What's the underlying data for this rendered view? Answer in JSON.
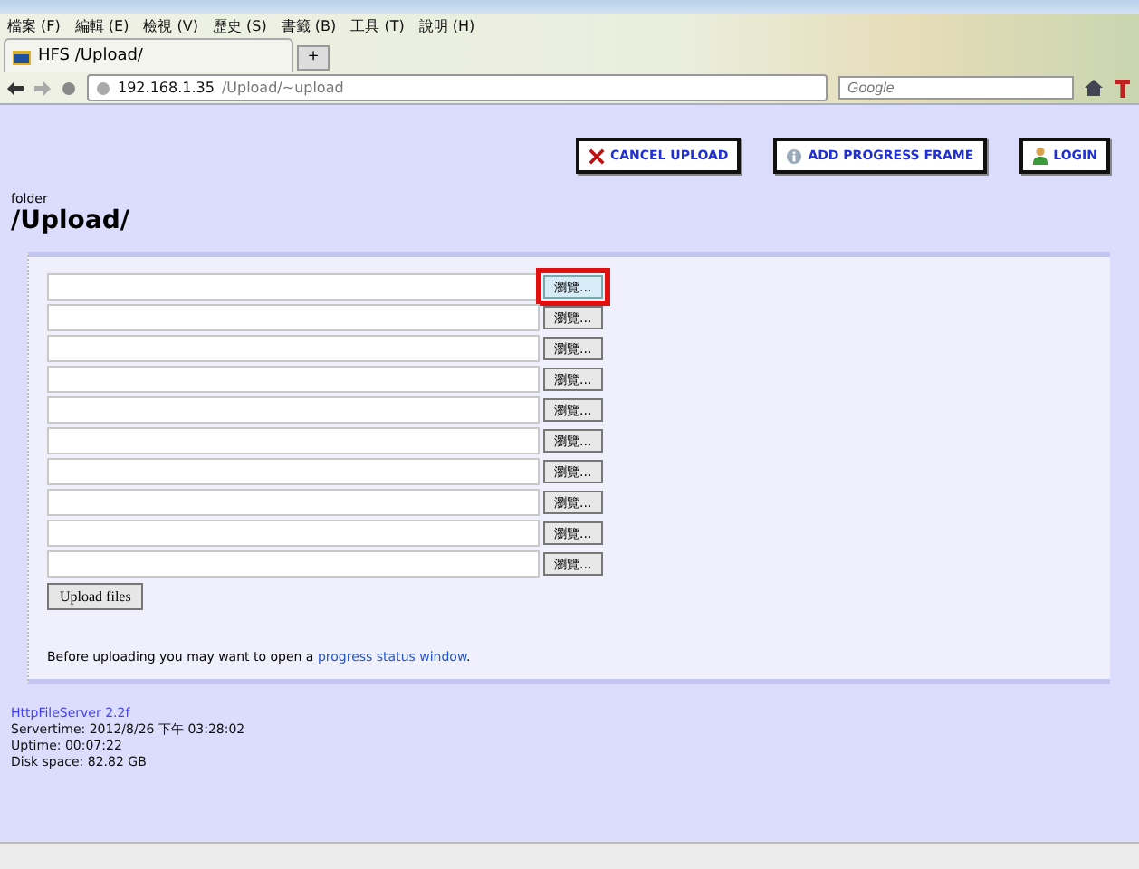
{
  "menu": [
    "檔案 (F)",
    "編輯 (E)",
    "檢視 (V)",
    "歷史 (S)",
    "書籤 (B)",
    "工具 (T)",
    "說明 (H)"
  ],
  "tab": {
    "title": "HFS /Upload/",
    "new_tab": "+"
  },
  "address": {
    "host": "192.168.1.35",
    "path": "/Upload/~upload"
  },
  "search": {
    "placeholder": "Google"
  },
  "actions": [
    {
      "kind": "cancel",
      "label": "CANCEL UPLOAD"
    },
    {
      "kind": "progress",
      "label": "ADD PROGRESS FRAME"
    },
    {
      "kind": "login",
      "label": "LOGIN"
    }
  ],
  "folder": {
    "caption": "folder",
    "path": "/Upload/"
  },
  "files": [
    {
      "browse": "瀏覽...",
      "highlighted": true
    },
    {
      "browse": "瀏覽...",
      "highlighted": false
    },
    {
      "browse": "瀏覽...",
      "highlighted": false
    },
    {
      "browse": "瀏覽...",
      "highlighted": false
    },
    {
      "browse": "瀏覽...",
      "highlighted": false
    },
    {
      "browse": "瀏覽...",
      "highlighted": false
    },
    {
      "browse": "瀏覽...",
      "highlighted": false
    },
    {
      "browse": "瀏覽...",
      "highlighted": false
    },
    {
      "browse": "瀏覽...",
      "highlighted": false
    },
    {
      "browse": "瀏覽...",
      "highlighted": false
    }
  ],
  "upload_button": "Upload files",
  "hint": {
    "before": "Before uploading you may want to open a ",
    "link": "progress status window",
    "after": "."
  },
  "footer": {
    "server": "HttpFileServer 2.2f",
    "lines": [
      "Servertime: 2012/8/26 下午 03:28:02",
      "Uptime: 00:07:22",
      "Disk space: 82.82 GB"
    ]
  }
}
